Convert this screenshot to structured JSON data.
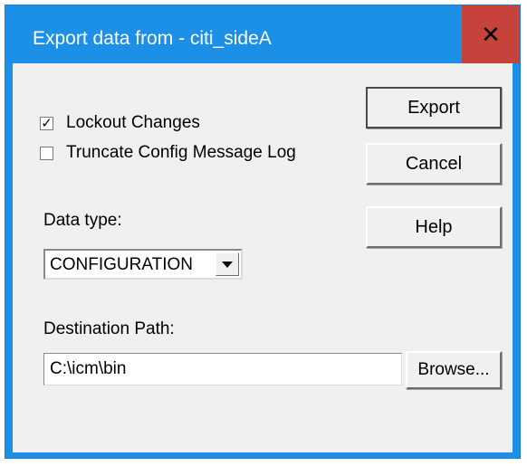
{
  "window": {
    "title": "Export data from - citi_sideA",
    "close_glyph": "✕"
  },
  "options": {
    "lockout_changes": {
      "label": "Lockout Changes",
      "checked": true
    },
    "truncate_log": {
      "label": "Truncate Config Message Log",
      "checked": false
    }
  },
  "data_type": {
    "label": "Data type:",
    "selected": "CONFIGURATION"
  },
  "destination": {
    "label": "Destination Path:",
    "value": "C:\\icm\\bin"
  },
  "buttons": {
    "export": "Export",
    "cancel": "Cancel",
    "help": "Help",
    "browse": "Browse..."
  },
  "colors": {
    "titlebar": "#1c8fe6",
    "close": "#c6433b",
    "client": "#f0f0f0"
  },
  "icons": [
    "close-icon",
    "checkmark-icon",
    "dropdown-arrow-icon"
  ]
}
